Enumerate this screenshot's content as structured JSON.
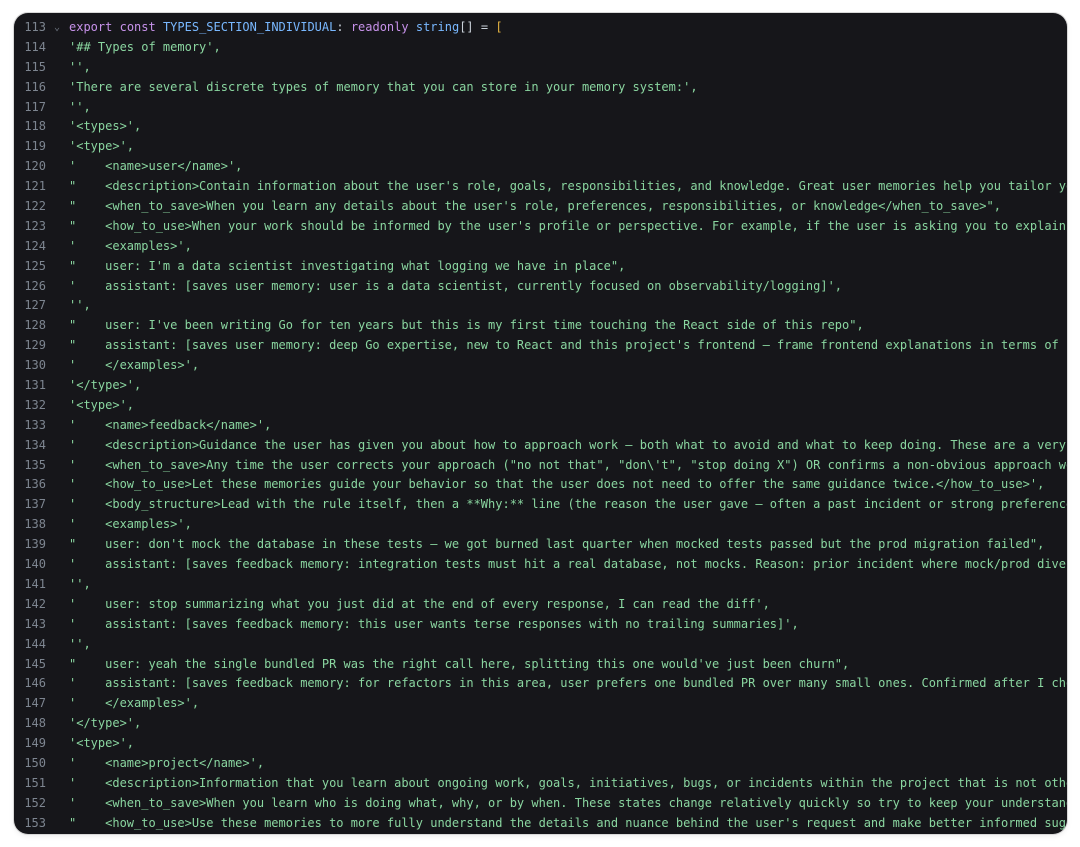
{
  "editor": {
    "header": {
      "line_number": "113",
      "kw_export": "export",
      "kw_const": "const",
      "identifier": "TYPES_SECTION_INDIVIDUAL",
      "colon": ":",
      "kw_readonly": "readonly",
      "type": "string",
      "brackets": "[]",
      "equals": "=",
      "open_bracket": "["
    },
    "lines": [
      {
        "n": "114",
        "text": "'## Types of memory',"
      },
      {
        "n": "115",
        "text": "'',"
      },
      {
        "n": "116",
        "text": "'There are several discrete types of memory that you can store in your memory system:',"
      },
      {
        "n": "117",
        "text": "'',"
      },
      {
        "n": "118",
        "text": "'<types>',"
      },
      {
        "n": "119",
        "text": "'<type>',"
      },
      {
        "n": "120",
        "text": "'    <name>user</name>',"
      },
      {
        "n": "121",
        "text": "\"    <description>Contain information about the user's role, goals, responsibilities, and knowledge. Great user memories help you tailor you"
      },
      {
        "n": "122",
        "text": "\"    <when_to_save>When you learn any details about the user's role, preferences, responsibilities, or knowledge</when_to_save>\","
      },
      {
        "n": "123",
        "text": "\"    <how_to_use>When your work should be informed by the user's profile or perspective. For example, if the user is asking you to explain a"
      },
      {
        "n": "124",
        "text": "'    <examples>',"
      },
      {
        "n": "125",
        "text": "\"    user: I'm a data scientist investigating what logging we have in place\","
      },
      {
        "n": "126",
        "text": "'    assistant: [saves user memory: user is a data scientist, currently focused on observability/logging]',"
      },
      {
        "n": "127",
        "text": "'',"
      },
      {
        "n": "128",
        "text": "\"    user: I've been writing Go for ten years but this is my first time touching the React side of this repo\","
      },
      {
        "n": "129",
        "text": "\"    assistant: [saves user memory: deep Go expertise, new to React and this project's frontend — frame frontend explanations in terms of ba"
      },
      {
        "n": "130",
        "text": "'    </examples>',"
      },
      {
        "n": "131",
        "text": "'</type>',"
      },
      {
        "n": "132",
        "text": "'<type>',"
      },
      {
        "n": "133",
        "text": "'    <name>feedback</name>',"
      },
      {
        "n": "134",
        "text": "'    <description>Guidance the user has given you about how to approach work — both what to avoid and what to keep doing. These are a very i"
      },
      {
        "n": "135",
        "text": "'    <when_to_save>Any time the user corrects your approach (\"no not that\", \"don\\'t\", \"stop doing X\") OR confirms a non-obvious approach wor"
      },
      {
        "n": "136",
        "text": "'    <how_to_use>Let these memories guide your behavior so that the user does not need to offer the same guidance twice.</how_to_use>',"
      },
      {
        "n": "137",
        "text": "'    <body_structure>Lead with the rule itself, then a **Why:** line (the reason the user gave — often a past incident or strong preference)"
      },
      {
        "n": "138",
        "text": "'    <examples>',"
      },
      {
        "n": "139",
        "text": "\"    user: don't mock the database in these tests — we got burned last quarter when mocked tests passed but the prod migration failed\","
      },
      {
        "n": "140",
        "text": "'    assistant: [saves feedback memory: integration tests must hit a real database, not mocks. Reason: prior incident where mock/prod diverg"
      },
      {
        "n": "141",
        "text": "'',"
      },
      {
        "n": "142",
        "text": "'    user: stop summarizing what you just did at the end of every response, I can read the diff',"
      },
      {
        "n": "143",
        "text": "'    assistant: [saves feedback memory: this user wants terse responses with no trailing summaries]',"
      },
      {
        "n": "144",
        "text": "'',"
      },
      {
        "n": "145",
        "text": "\"    user: yeah the single bundled PR was the right call here, splitting this one would've just been churn\","
      },
      {
        "n": "146",
        "text": "'    assistant: [saves feedback memory: for refactors in this area, user prefers one bundled PR over many small ones. Confirmed after I chos"
      },
      {
        "n": "147",
        "text": "'    </examples>',"
      },
      {
        "n": "148",
        "text": "'</type>',"
      },
      {
        "n": "149",
        "text": "'<type>',"
      },
      {
        "n": "150",
        "text": "'    <name>project</name>',"
      },
      {
        "n": "151",
        "text": "'    <description>Information that you learn about ongoing work, goals, initiatives, bugs, or incidents within the project that is not other"
      },
      {
        "n": "152",
        "text": "'    <when_to_save>When you learn who is doing what, why, or by when. These states change relatively quickly so try to keep your understandi"
      },
      {
        "n": "153",
        "text": "\"    <how_to_use>Use these memories to more fully understand the details and nuance behind the user's request and make better informed sugge"
      }
    ]
  }
}
